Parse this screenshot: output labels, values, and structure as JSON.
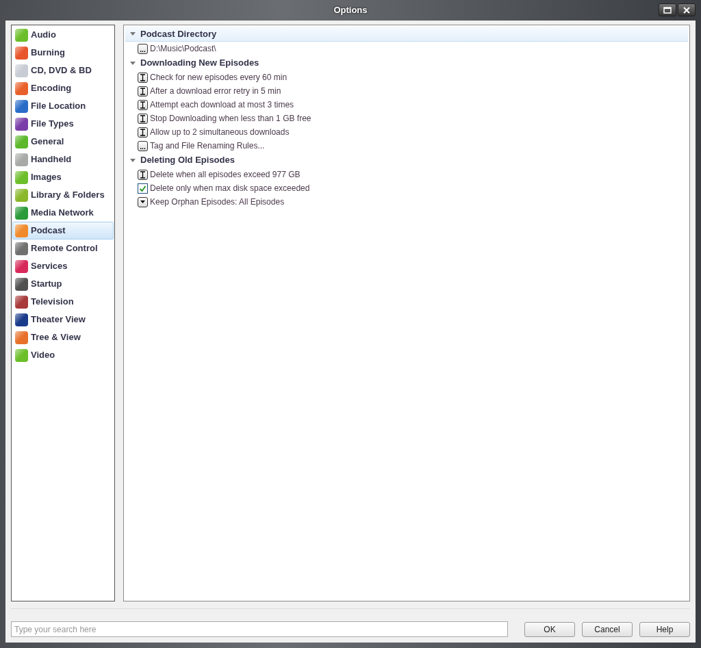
{
  "window": {
    "title": "Options"
  },
  "sidebar": {
    "items": [
      {
        "label": "Audio",
        "selected": false,
        "color": "#6cbf2a"
      },
      {
        "label": "Burning",
        "selected": false,
        "color": "#e8552a"
      },
      {
        "label": "CD, DVD & BD",
        "selected": false,
        "color": "#c8ccd4"
      },
      {
        "label": "Encoding",
        "selected": false,
        "color": "#e8602a"
      },
      {
        "label": "File Location",
        "selected": false,
        "color": "#2a6cc8"
      },
      {
        "label": "File Types",
        "selected": false,
        "color": "#7a3ea8"
      },
      {
        "label": "General",
        "selected": false,
        "color": "#5cb82a"
      },
      {
        "label": "Handheld",
        "selected": false,
        "color": "#a8aaa8"
      },
      {
        "label": "Images",
        "selected": false,
        "color": "#6cbf2a"
      },
      {
        "label": "Library & Folders",
        "selected": false,
        "color": "#8ab82a"
      },
      {
        "label": "Media Network",
        "selected": false,
        "color": "#2a9a3a"
      },
      {
        "label": "Podcast",
        "selected": true,
        "color": "#f08a2a"
      },
      {
        "label": "Remote Control",
        "selected": false,
        "color": "#707070"
      },
      {
        "label": "Services",
        "selected": false,
        "color": "#d82a5a"
      },
      {
        "label": "Startup",
        "selected": false,
        "color": "#505050"
      },
      {
        "label": "Television",
        "selected": false,
        "color": "#a83a3a"
      },
      {
        "label": "Theater View",
        "selected": false,
        "color": "#1a3a8a"
      },
      {
        "label": "Tree & View",
        "selected": false,
        "color": "#e8702a"
      },
      {
        "label": "Video",
        "selected": false,
        "color": "#6cbf2a"
      }
    ]
  },
  "sections": [
    {
      "title": "Podcast Directory",
      "expanded": true,
      "selected": true,
      "items": [
        {
          "kind": "button",
          "glyph": "...",
          "label": "D:\\Music\\Podcast\\"
        }
      ]
    },
    {
      "title": "Downloading New Episodes",
      "expanded": true,
      "selected": false,
      "items": [
        {
          "kind": "edit",
          "label": "Check for new episodes every 60 min"
        },
        {
          "kind": "edit",
          "label": "After a download error retry in 5 min"
        },
        {
          "kind": "edit",
          "label": "Attempt each download at most 3 times"
        },
        {
          "kind": "edit",
          "label": "Stop Downloading when less than 1 GB free"
        },
        {
          "kind": "edit",
          "label": "Allow up to 2 simultaneous downloads"
        },
        {
          "kind": "button",
          "glyph": "...",
          "label": "Tag and File Renaming Rules..."
        }
      ]
    },
    {
      "title": "Deleting Old Episodes",
      "expanded": true,
      "selected": false,
      "items": [
        {
          "kind": "edit",
          "label": "Delete when all episodes exceed 977 GB"
        },
        {
          "kind": "checkbox",
          "checked": true,
          "label": "Delete only when max disk space exceeded"
        },
        {
          "kind": "dropdown",
          "label": "Keep Orphan Episodes: All Episodes"
        }
      ]
    }
  ],
  "search": {
    "placeholder": "Type your search here"
  },
  "buttons": [
    "OK",
    "Cancel",
    "Help"
  ]
}
